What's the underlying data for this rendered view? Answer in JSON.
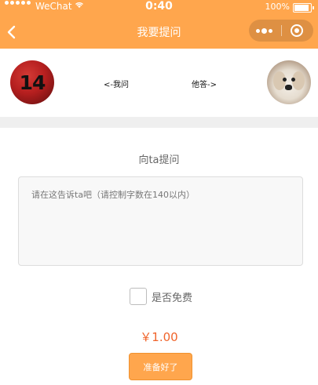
{
  "status_bar": {
    "carrier": "WeChat",
    "time": "0:40",
    "battery_text": "100%",
    "battery_level": 1.0
  },
  "header": {
    "title": "我要提问",
    "back_icon": "chevron-left-icon",
    "more_icon": "more-dots-icon",
    "close_icon": "target-circle-icon"
  },
  "people": {
    "left_avatar_text": "14",
    "ask_link": "<-我问",
    "answer_link": "他答->"
  },
  "form": {
    "question_label": "向ta提问",
    "question_placeholder": "请在这告诉ta吧（请控制字数在140以内）",
    "question_value": "",
    "free_label": "是否免费",
    "free_checked": false,
    "price": "￥1.00",
    "submit_label": "准备好了"
  },
  "colors": {
    "accent": "#ffa64d",
    "price": "#f0642b",
    "band": "#efefef"
  }
}
